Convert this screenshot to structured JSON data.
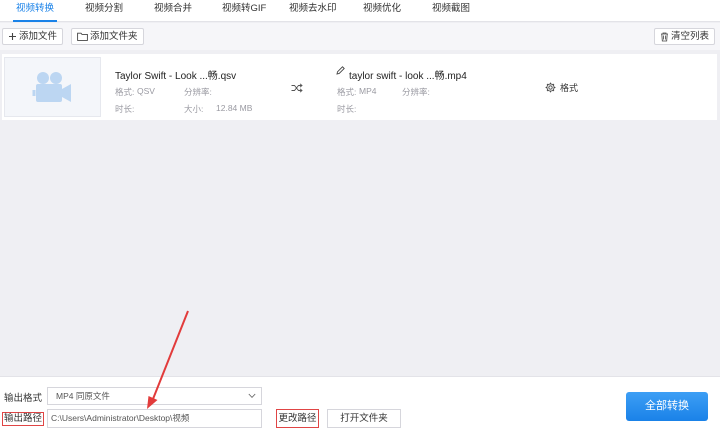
{
  "tabs": [
    {
      "label": "视频转换",
      "active": true
    },
    {
      "label": "视频分割"
    },
    {
      "label": "视频合并"
    },
    {
      "label": "视频转GIF"
    },
    {
      "label": "视频去水印"
    },
    {
      "label": "视频优化"
    },
    {
      "label": "视频截图"
    }
  ],
  "toolbar": {
    "add_file": "添加文件",
    "add_folder": "添加文件夹",
    "clear_list": "清空列表"
  },
  "file": {
    "source": {
      "name": "Taylor Swift - Look ...畅.qsv",
      "format_label": "格式:",
      "format_value": "QSV",
      "resolution_label": "分辨率:",
      "duration_label": "时长:",
      "size_label": "大小:",
      "size_value": "12.84 MB"
    },
    "output": {
      "name": "taylor swift - look ...畅.mp4",
      "format_label": "格式:",
      "format_value": "MP4",
      "resolution_label": "分辨率:",
      "duration_label": "时长:"
    },
    "settings_label": "格式"
  },
  "bottom": {
    "output_format_label": "输出格式",
    "output_format_value": "MP4  同原文件",
    "output_path_label": "输出路径",
    "output_path_value": "C:\\Users\\Administrator\\Desktop\\视频",
    "change_path": "更改路径",
    "open_folder": "打开文件夹",
    "convert_all": "全部转换"
  },
  "colors": {
    "accent": "#1a82e8",
    "highlight_box": "#e04545"
  }
}
